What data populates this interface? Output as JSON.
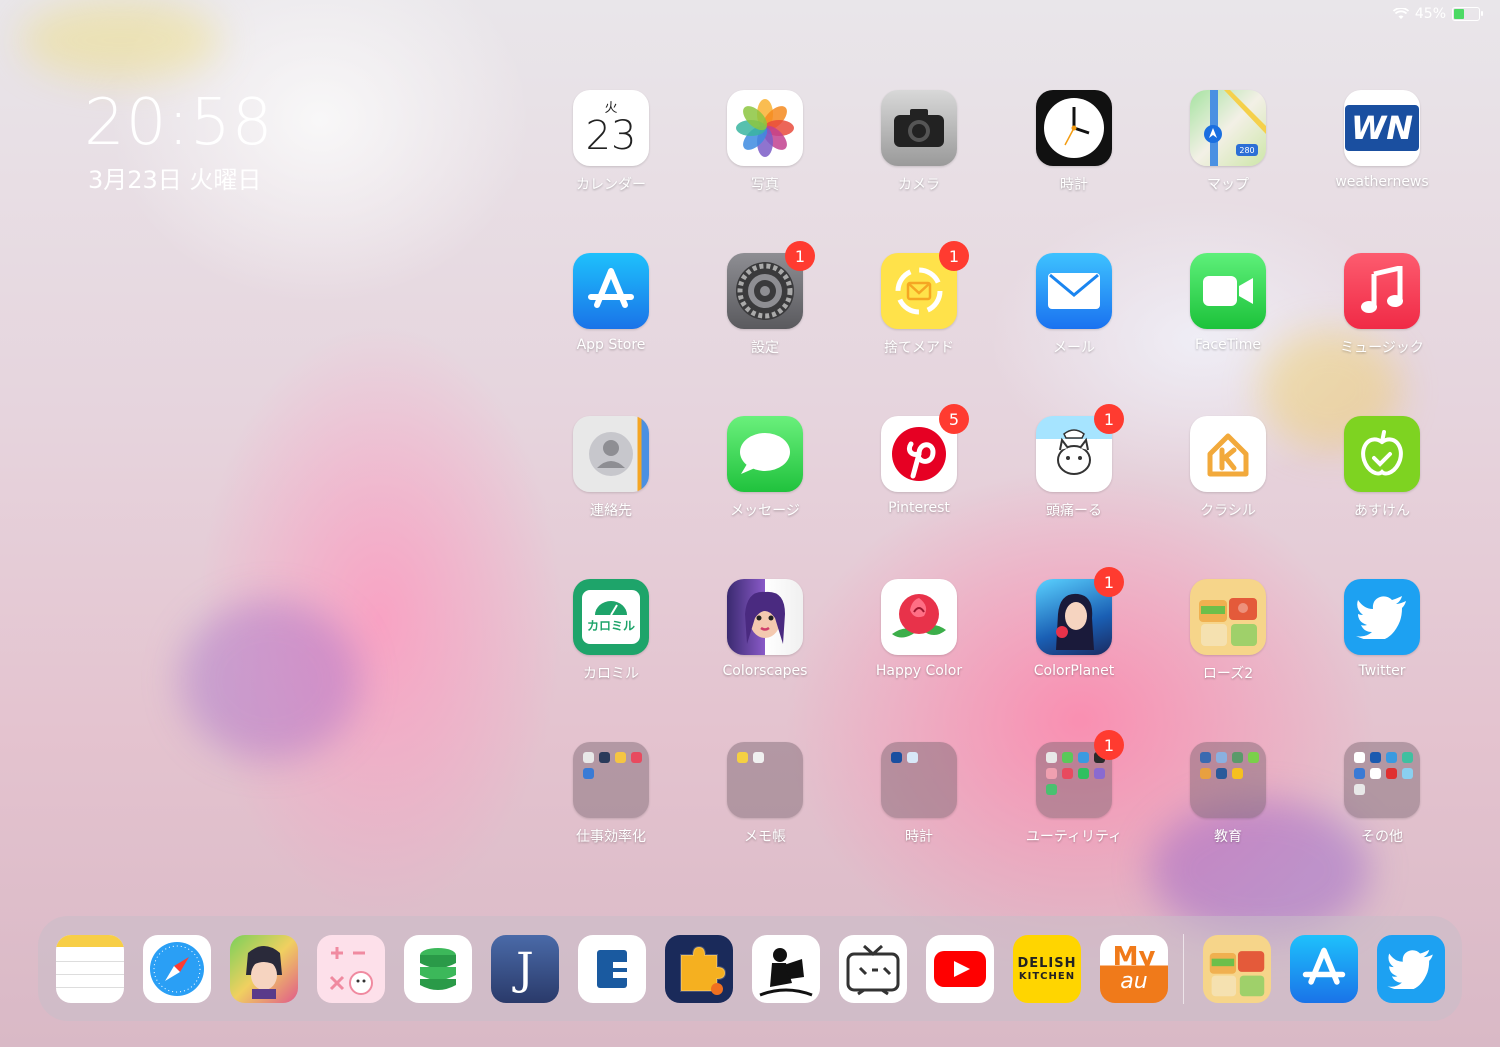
{
  "status_bar": {
    "battery_percent": "45%",
    "battery_level": 0.45
  },
  "lock_widget": {
    "time": "20:58",
    "date": "3月23日 火曜日"
  },
  "calendar_icon": {
    "weekday": "火",
    "day": "23"
  },
  "apps": [
    {
      "label": "カレンダー",
      "badge": ""
    },
    {
      "label": "写真",
      "badge": ""
    },
    {
      "label": "カメラ",
      "badge": ""
    },
    {
      "label": "時計",
      "badge": ""
    },
    {
      "label": "マップ",
      "badge": ""
    },
    {
      "label": "weathernews",
      "badge": ""
    },
    {
      "label": "App Store",
      "badge": ""
    },
    {
      "label": "設定",
      "badge": "1"
    },
    {
      "label": "捨てメアド",
      "badge": "1"
    },
    {
      "label": "メール",
      "badge": ""
    },
    {
      "label": "FaceTime",
      "badge": ""
    },
    {
      "label": "ミュージック",
      "badge": ""
    },
    {
      "label": "連絡先",
      "badge": ""
    },
    {
      "label": "メッセージ",
      "badge": ""
    },
    {
      "label": "Pinterest",
      "badge": "5"
    },
    {
      "label": "頭痛ーる",
      "badge": "1"
    },
    {
      "label": "クラシル",
      "badge": ""
    },
    {
      "label": "あすけん",
      "badge": ""
    },
    {
      "label": "カロミル",
      "badge": ""
    },
    {
      "label": "Colorscapes",
      "badge": ""
    },
    {
      "label": "Happy Color",
      "badge": ""
    },
    {
      "label": "ColorPlanet",
      "badge": "1"
    },
    {
      "label": "ローズ2",
      "badge": ""
    },
    {
      "label": "Twitter",
      "badge": ""
    },
    {
      "label": "仕事効率化",
      "badge": ""
    },
    {
      "label": "メモ帳",
      "badge": ""
    },
    {
      "label": "時計",
      "badge": ""
    },
    {
      "label": "ユーティリティ",
      "badge": "1"
    },
    {
      "label": "教育",
      "badge": ""
    },
    {
      "label": "その他",
      "badge": ""
    }
  ],
  "icon_text": {
    "weathernews": "WN",
    "kalomil": "カロミル",
    "delish_top": "DELISH",
    "delish_bottom": "KITCHEN",
    "myau_top": "My",
    "myau_bottom": "au",
    "maps_route": "280",
    "j_app": "J"
  },
  "dock": [
    {
      "name": "notes"
    },
    {
      "name": "safari"
    },
    {
      "name": "pocket-game"
    },
    {
      "name": "calculator-sheep"
    },
    {
      "name": "coins"
    },
    {
      "name": "j-app"
    },
    {
      "name": "e-app"
    },
    {
      "name": "puzzle"
    },
    {
      "name": "kindle"
    },
    {
      "name": "niconico"
    },
    {
      "name": "youtube"
    },
    {
      "name": "delish-kitchen"
    },
    {
      "name": "my-au"
    },
    {
      "name": "recent-rose2"
    },
    {
      "name": "recent-app-store"
    },
    {
      "name": "recent-twitter"
    }
  ],
  "colors": {
    "badge": "#ff3b30",
    "twitter": "#1da1f2",
    "appstore": "#1a8cff"
  }
}
